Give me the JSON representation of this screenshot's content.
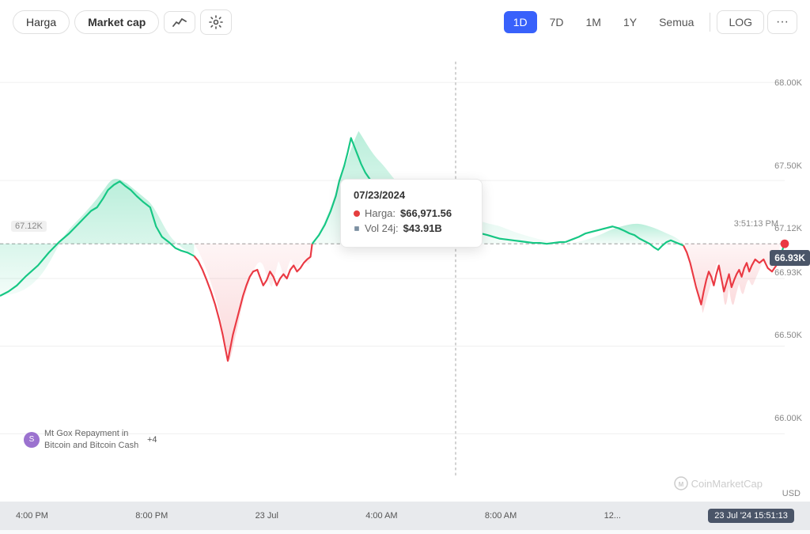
{
  "toolbar": {
    "tabs": [
      {
        "id": "harga",
        "label": "Harga",
        "active": false
      },
      {
        "id": "market-cap",
        "label": "Market cap",
        "active": false
      }
    ],
    "icon_line": "∿",
    "icon_settings": "⧉",
    "time_buttons": [
      {
        "id": "1d",
        "label": "1D",
        "active": true
      },
      {
        "id": "7d",
        "label": "7D",
        "active": false
      },
      {
        "id": "1m",
        "label": "1M",
        "active": false
      },
      {
        "id": "1y",
        "label": "1Y",
        "active": false
      },
      {
        "id": "semua",
        "label": "Semua",
        "active": false
      }
    ],
    "log_label": "LOG",
    "more_label": "···"
  },
  "chart": {
    "y_axis": [
      {
        "value": "68.00K",
        "pct": 8
      },
      {
        "value": "67.50K",
        "pct": 28
      },
      {
        "value": "67.12K",
        "pct": 41
      },
      {
        "value": "66.93K",
        "pct": 48
      },
      {
        "value": "66.50K",
        "pct": 62
      },
      {
        "value": "66.00K",
        "pct": 80
      }
    ],
    "open_price_label": "67.12K",
    "current_price_label": "66.93K",
    "usd_label": "USD",
    "watermark": "CoinMarketCap"
  },
  "tooltip": {
    "date": "07/23/2024",
    "time": "3:51:13 PM",
    "price_label": "Harga:",
    "price_value": "$66,971.56",
    "vol_label": "Vol 24j:",
    "vol_value": "$43.91B"
  },
  "x_axis": {
    "labels": [
      "4:00 PM",
      "8:00 PM",
      "23 Jul",
      "4:00 AM",
      "8:00 AM",
      "12..."
    ],
    "highlight": "23 Jul '24 15:51:13"
  },
  "event": {
    "icon": "S",
    "text": "Mt Gox Repayment in Bitcoin and Bitcoin Cash",
    "badge": "+4"
  }
}
